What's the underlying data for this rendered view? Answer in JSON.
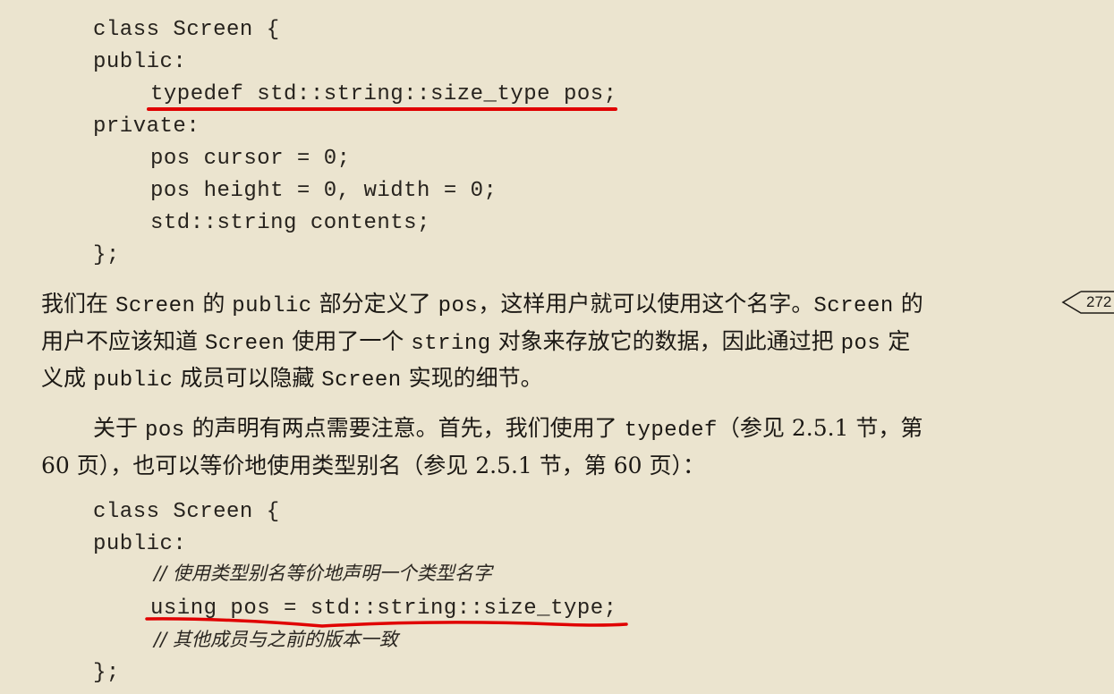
{
  "code_block_1": {
    "line1": "class Screen {",
    "line2": "public:",
    "line3": "typedef std::string::size_type pos;",
    "line4": "private:",
    "line5": "pos cursor = 0;",
    "line6": "pos height = 0, width = 0;",
    "line7": "std::string contents;",
    "line8": "};"
  },
  "paragraph1": {
    "l1a": "我们在 ",
    "l1b": "Screen",
    "l1c": " 的 ",
    "l1d": "public",
    "l1e": " 部分定义了 ",
    "l1f": "pos",
    "l1g": "，这样用户就可以使用这个名字。",
    "l1h": "Screen",
    "l1i": " 的",
    "l2a": "用户不应该知道 ",
    "l2b": "Screen",
    "l2c": " 使用了一个 ",
    "l2d": "string",
    "l2e": " 对象来存放它的数据，因此通过把 ",
    "l2f": "pos",
    "l2g": " 定",
    "l3a": "义成 ",
    "l3b": "public",
    "l3c": " 成员可以隐藏 ",
    "l3d": "Screen",
    "l3e": " 实现的细节。"
  },
  "margin_page_ref": "272",
  "paragraph2": {
    "l1a": "关于 ",
    "l1b": "pos",
    "l1c": " 的声明有两点需要注意。首先，我们使用了 ",
    "l1d": "typedef",
    "l1e": "（参见 2.5.1 节，第",
    "l2": "60 页），也可以等价地使用类型别名（参见 2.5.1 节，第 60 页）："
  },
  "code_block_2": {
    "line1": "class Screen {",
    "line2": "public:",
    "comment1": "// 使用类型别名等价地声明一个类型名字",
    "line3": "using pos = std::string::size_type;",
    "comment2": "// 其他成员与之前的版本一致",
    "line4": "};"
  },
  "annotation_color": "#e00000",
  "page_background": "#ebe4cf"
}
